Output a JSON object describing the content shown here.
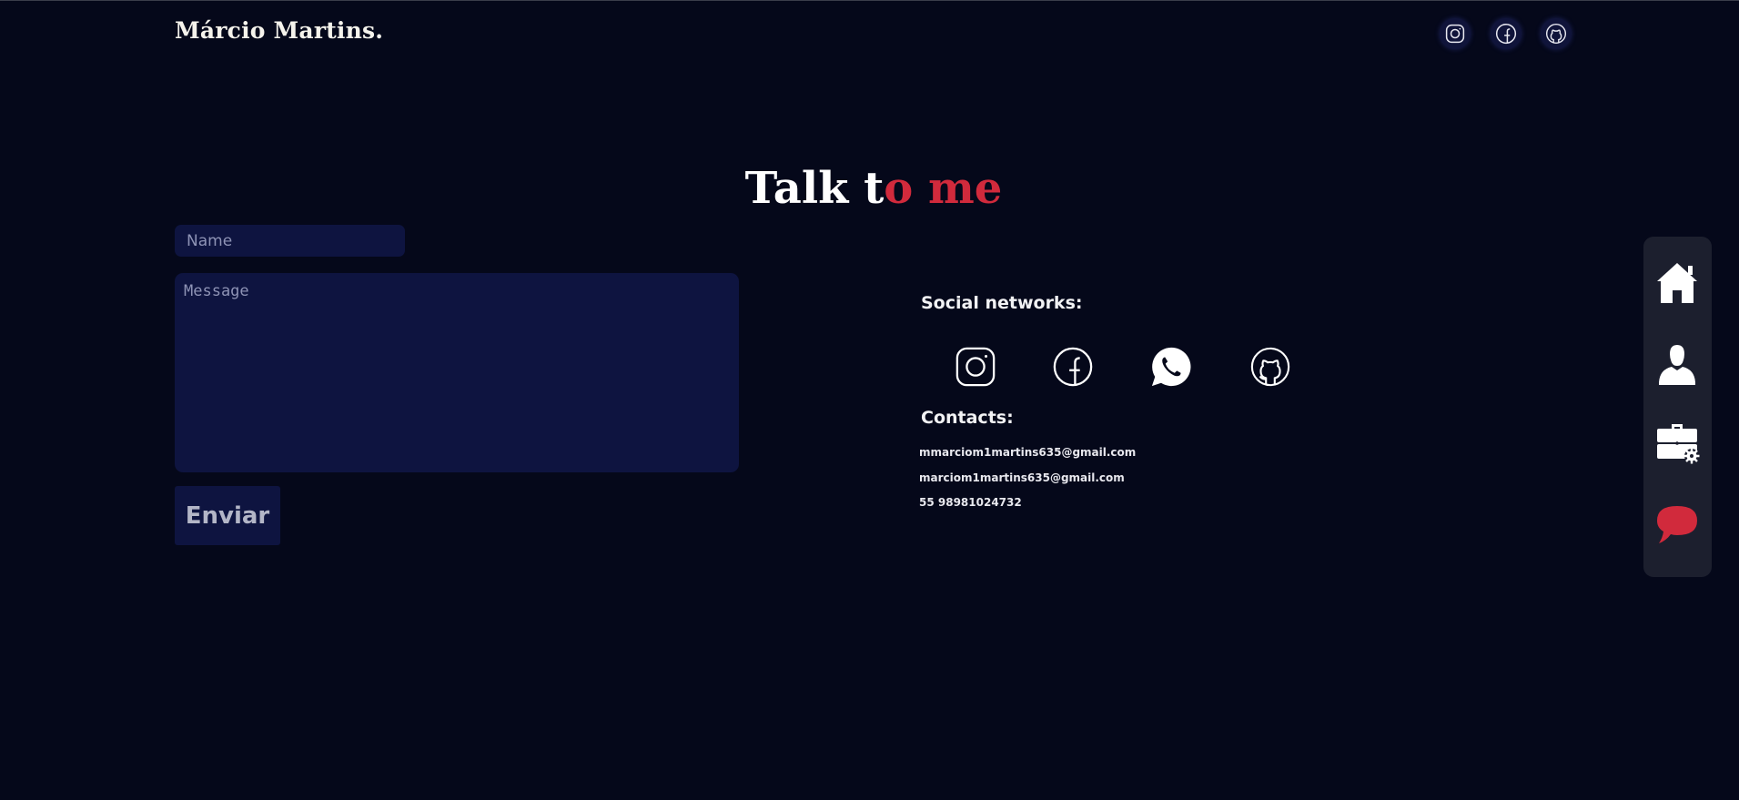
{
  "header": {
    "brand": "Márcio Martins.",
    "social_icons": [
      "instagram-icon",
      "facebook-icon",
      "github-icon"
    ]
  },
  "contact": {
    "title_part1": "Talk t",
    "title_part2": "o me",
    "form": {
      "name_placeholder": "Name",
      "message_placeholder": "Message",
      "submit_label": "Enviar"
    },
    "social_label": "Social networks:",
    "social_icons": [
      "instagram-icon",
      "facebook-icon",
      "whatsapp-icon",
      "github-icon"
    ],
    "contacts_label": "Contacts:",
    "contacts": [
      "mmarciom1martins635@gmail.com",
      "marciom1martins635@gmail.com",
      "55 98981024732"
    ]
  },
  "sidenav": {
    "items": [
      "home-icon",
      "user-icon",
      "briefcase-icon",
      "chat-icon"
    ]
  },
  "colors": {
    "background": "#05081a",
    "accent": "#d12a3c",
    "input_bg": "#0e1440",
    "sidenav_bg": "#1c1f2e"
  }
}
